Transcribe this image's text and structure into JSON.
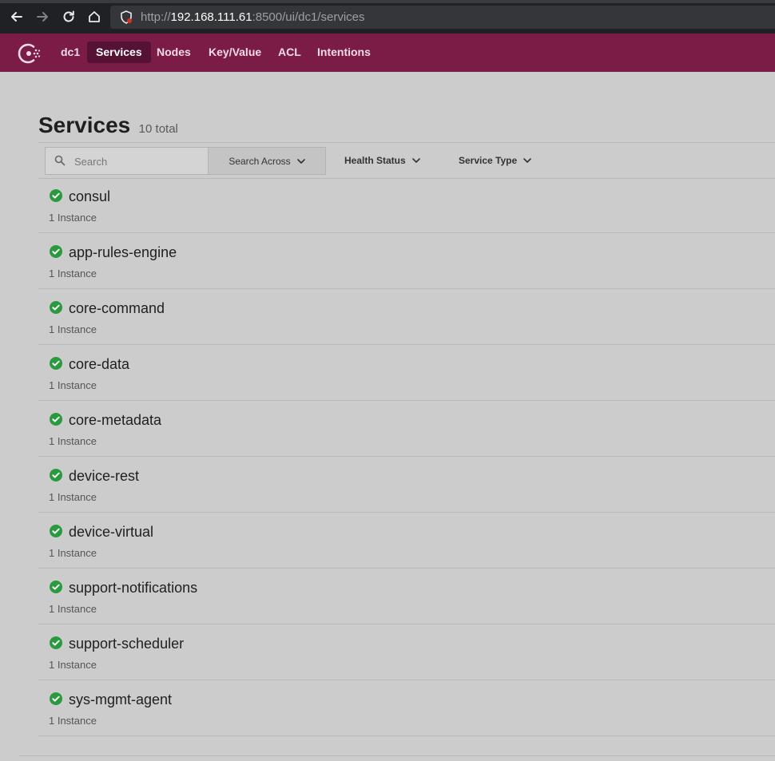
{
  "browser": {
    "url_scheme": "http://",
    "url_host": "192.168.111.61",
    "url_rest": ":8500/ui/dc1/services"
  },
  "header": {
    "datacenter": "dc1",
    "nav": [
      "Services",
      "Nodes",
      "Key/Value",
      "ACL",
      "Intentions"
    ],
    "active": "Services"
  },
  "main": {
    "title": "Services",
    "count": "10 total",
    "search_placeholder": "Search",
    "search_across": "Search Across",
    "health_status": "Health Status",
    "service_type": "Service Type"
  },
  "services": [
    {
      "name": "consul",
      "instances": "1 Instance"
    },
    {
      "name": "app-rules-engine",
      "instances": "1 Instance"
    },
    {
      "name": "core-command",
      "instances": "1 Instance"
    },
    {
      "name": "core-data",
      "instances": "1 Instance"
    },
    {
      "name": "core-metadata",
      "instances": "1 Instance"
    },
    {
      "name": "device-rest",
      "instances": "1 Instance"
    },
    {
      "name": "device-virtual",
      "instances": "1 Instance"
    },
    {
      "name": "support-notifications",
      "instances": "1 Instance"
    },
    {
      "name": "support-scheduler",
      "instances": "1 Instance"
    },
    {
      "name": "sys-mgmt-agent",
      "instances": "1 Instance"
    }
  ],
  "colors": {
    "header_bg": "#7b1c47",
    "active_nav_bg": "#551234",
    "health_passing": "#2a9a3f"
  },
  "icons": {
    "health": "check-circle-icon",
    "search": "search-icon",
    "dropdown": "chevron-down-icon"
  }
}
